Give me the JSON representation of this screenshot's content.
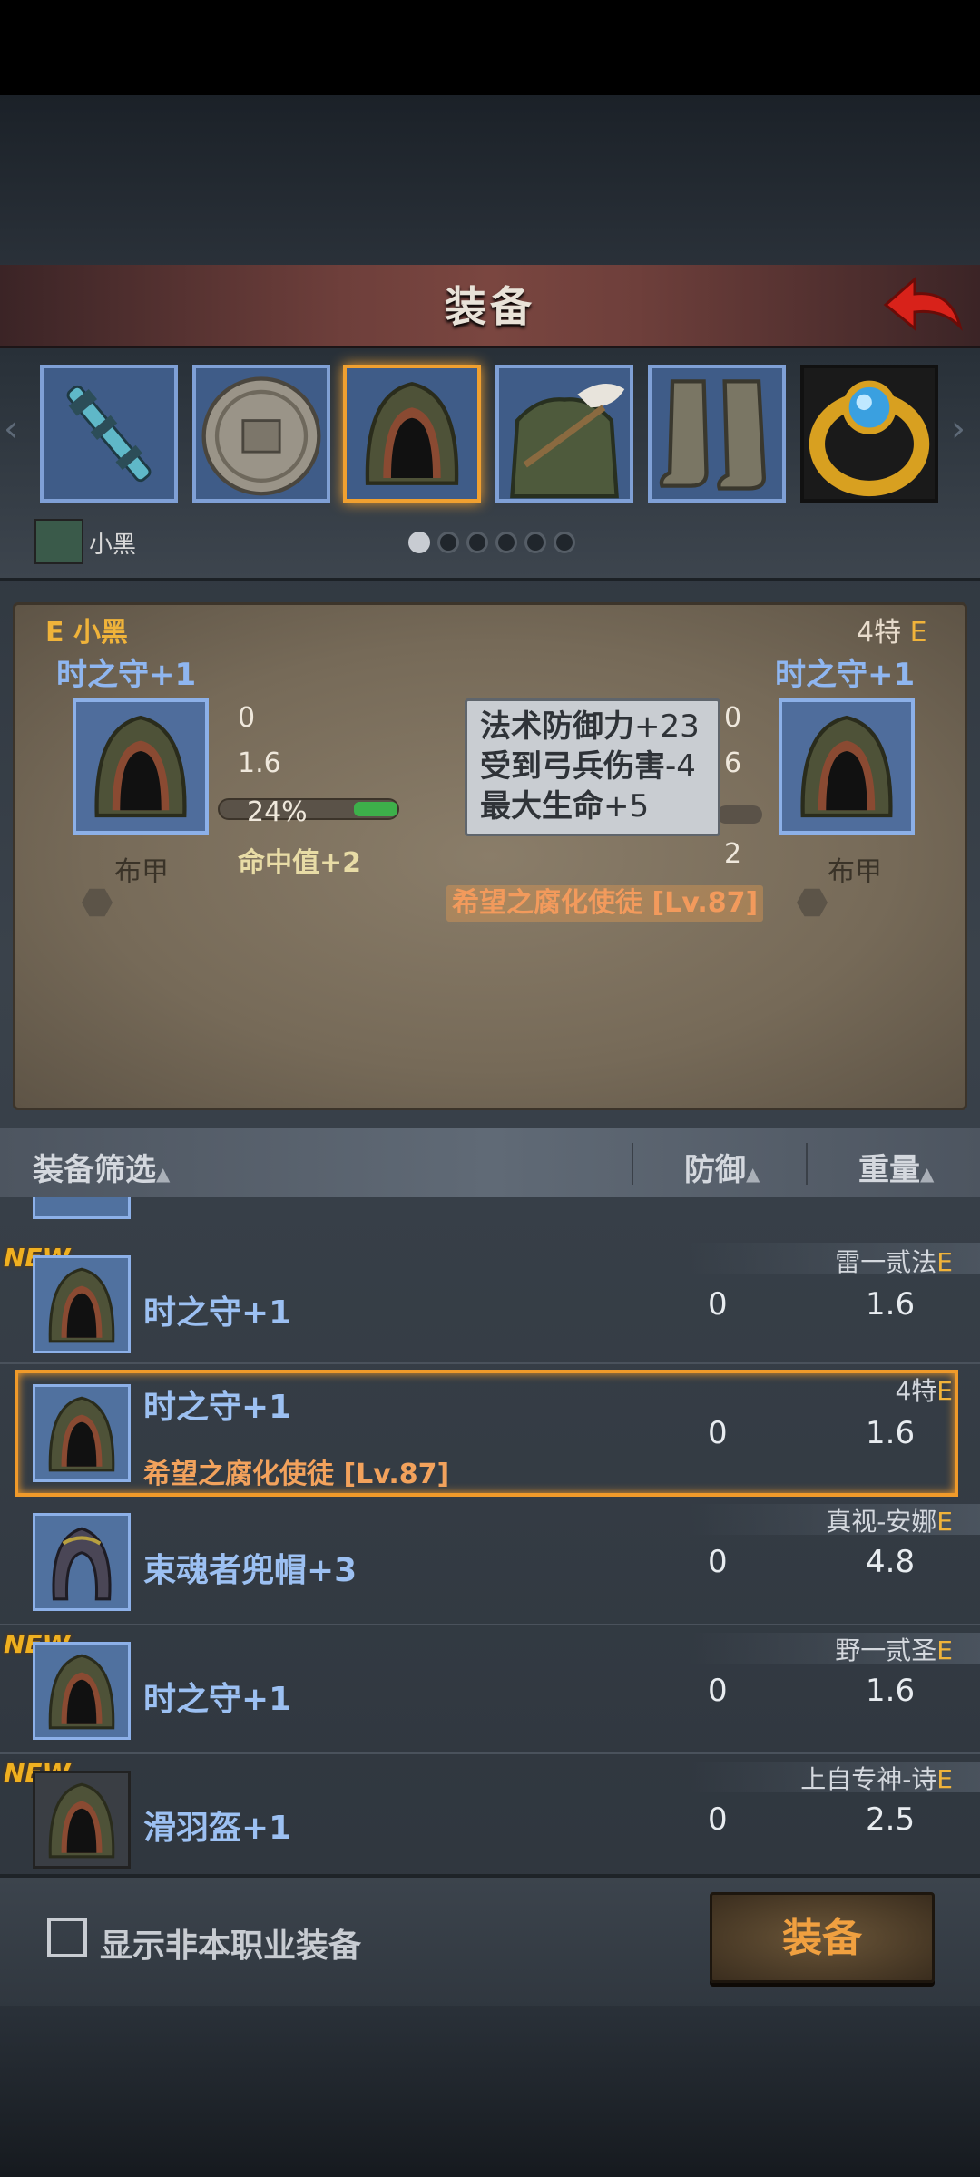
{
  "header": {
    "title": "装备"
  },
  "slots": [
    {
      "name": "weapon",
      "icon": "scepter-icon",
      "selected": false
    },
    {
      "name": "shield",
      "icon": "shield-icon",
      "selected": false
    },
    {
      "name": "hood",
      "icon": "hood-icon",
      "selected": true
    },
    {
      "name": "armor",
      "icon": "armor-icon",
      "selected": false
    },
    {
      "name": "boots",
      "icon": "boots-icon",
      "selected": false
    },
    {
      "name": "ring",
      "icon": "ring-icon",
      "selected": false
    }
  ],
  "character": {
    "name": "小黑",
    "page_dots": 6,
    "active_dot": 0
  },
  "compare": {
    "left": {
      "owner_tag": "E 小黑",
      "item_name": "时之守+1",
      "type": "布甲",
      "stat1": "0",
      "stat2": "1.6",
      "percent": "24%",
      "hit": "命中值+2"
    },
    "right": {
      "owner_tag": "4特",
      "owner_grade": "E",
      "item_name": "时之守+1",
      "type": "布甲",
      "stat1": "0",
      "stat2": "6",
      "stat3": "2"
    },
    "tooltip": [
      {
        "label": "法术防御力",
        "value": "+23"
      },
      {
        "label": "受到弓兵伤害",
        "value": "-4"
      },
      {
        "label": "最大生命",
        "value": "+5"
      }
    ],
    "set_label": "希望之腐化使徒 [Lv.87]"
  },
  "list_header": {
    "filter": "装备筛选",
    "defense": "防御",
    "weight": "重量"
  },
  "items": [
    {
      "new": "NEW",
      "name": "时之守+1",
      "owner": "雷一贰法",
      "grade": "E",
      "defense": "0",
      "weight": "1.6"
    },
    {
      "new": "",
      "name": "时之守+1",
      "owner": "4特",
      "grade": "E",
      "defense": "0",
      "weight": "1.6",
      "set": "希望之腐化使徒 [Lv.87]"
    },
    {
      "new": "",
      "name": "束魂者兜帽+3",
      "owner": "真视-安娜",
      "grade": "E",
      "defense": "0",
      "weight": "4.8"
    },
    {
      "new": "NEW",
      "name": "时之守+1",
      "owner": "野一贰圣",
      "grade": "E",
      "defense": "0",
      "weight": "1.6"
    },
    {
      "new": "NEW",
      "name": "滑羽盔+1",
      "owner": "上自专神-诗",
      "grade": "E",
      "defense": "0",
      "weight": "2.5"
    }
  ],
  "footer": {
    "checkbox_label": "显示非本职业装备",
    "equip_button": "装备"
  },
  "colors": {
    "accent": "#f0a030",
    "grade": "#f0b33a",
    "item_name": "#9cc0f2",
    "set": "#f2a25c"
  }
}
